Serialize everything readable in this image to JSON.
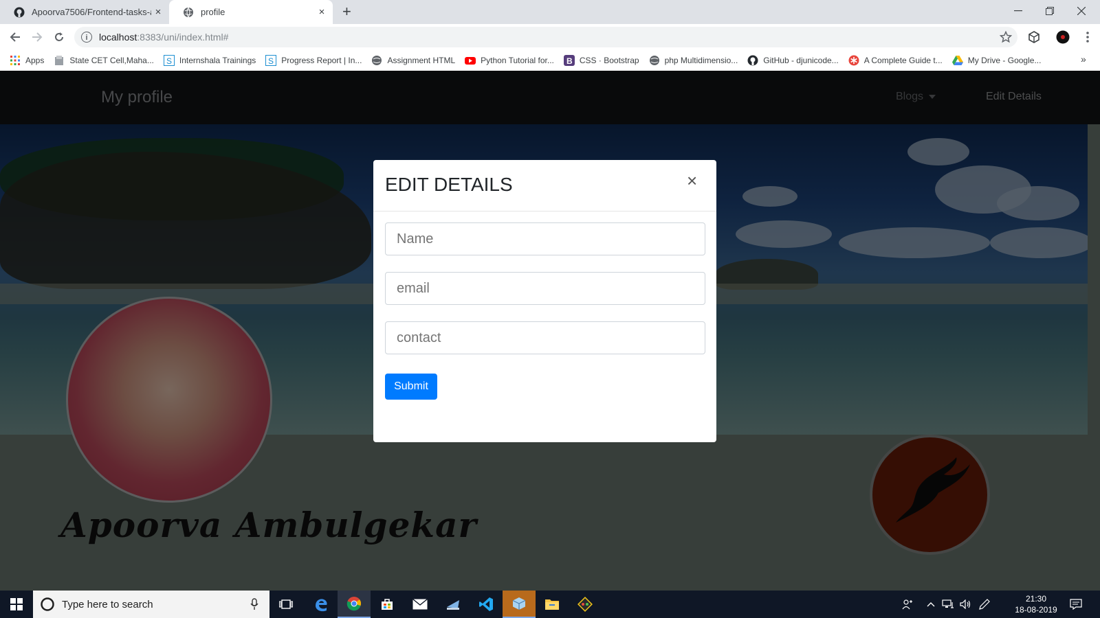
{
  "browser": {
    "tabs": [
      {
        "title": "Apoorva7506/Frontend-tasks-an",
        "icon": "github-icon",
        "active": false
      },
      {
        "title": "profile",
        "icon": "globe-icon",
        "active": true
      }
    ],
    "new_tab": "+",
    "close_glyph": "×",
    "address": {
      "host": "localhost",
      "rest": ":8383/uni/index.html#"
    },
    "bookmarks": [
      {
        "label": "Apps",
        "icon": "apps-grid-icon"
      },
      {
        "label": "State CET Cell,Maha...",
        "icon": "document-icon"
      },
      {
        "label": "Internshala Trainings",
        "icon": "internshala-icon"
      },
      {
        "label": "Progress Report | In...",
        "icon": "internshala-icon"
      },
      {
        "label": "Assignment HTML",
        "icon": "globe-icon"
      },
      {
        "label": "Python Tutorial for...",
        "icon": "youtube-icon"
      },
      {
        "label": "CSS · Bootstrap",
        "icon": "bootstrap-icon"
      },
      {
        "label": "php Multidimensio...",
        "icon": "globe-icon"
      },
      {
        "label": "GitHub - djunicode...",
        "icon": "github-icon"
      },
      {
        "label": "A Complete Guide t...",
        "icon": "asterisk-icon"
      },
      {
        "label": "My Drive - Google...",
        "icon": "google-drive-icon"
      }
    ],
    "overflow": "»"
  },
  "site": {
    "brand": "My profile",
    "nav": {
      "blogs": "Blogs",
      "edit": "Edit Details"
    },
    "profile_name": "Apoorva Ambulgekar"
  },
  "modal": {
    "title": "EDIT DETAILS",
    "close": "×",
    "fields": {
      "name": {
        "placeholder": "Name",
        "value": ""
      },
      "email": {
        "placeholder": "email",
        "value": ""
      },
      "contact": {
        "placeholder": "contact",
        "value": ""
      }
    },
    "submit": "Submit"
  },
  "taskbar": {
    "search_placeholder": "Type here to search",
    "apps": [
      "task-view-icon",
      "edge-icon",
      "chrome-icon",
      "store-icon",
      "mail-icon",
      "file-transfer-icon",
      "vscode-icon",
      "app-cube-icon",
      "file-explorer-icon",
      "git-icon"
    ],
    "time": "21:30",
    "date": "18-08-2019"
  },
  "colors": {
    "accent": "#007bff",
    "navbar": "#121416",
    "taskbar": "#0f1726"
  }
}
